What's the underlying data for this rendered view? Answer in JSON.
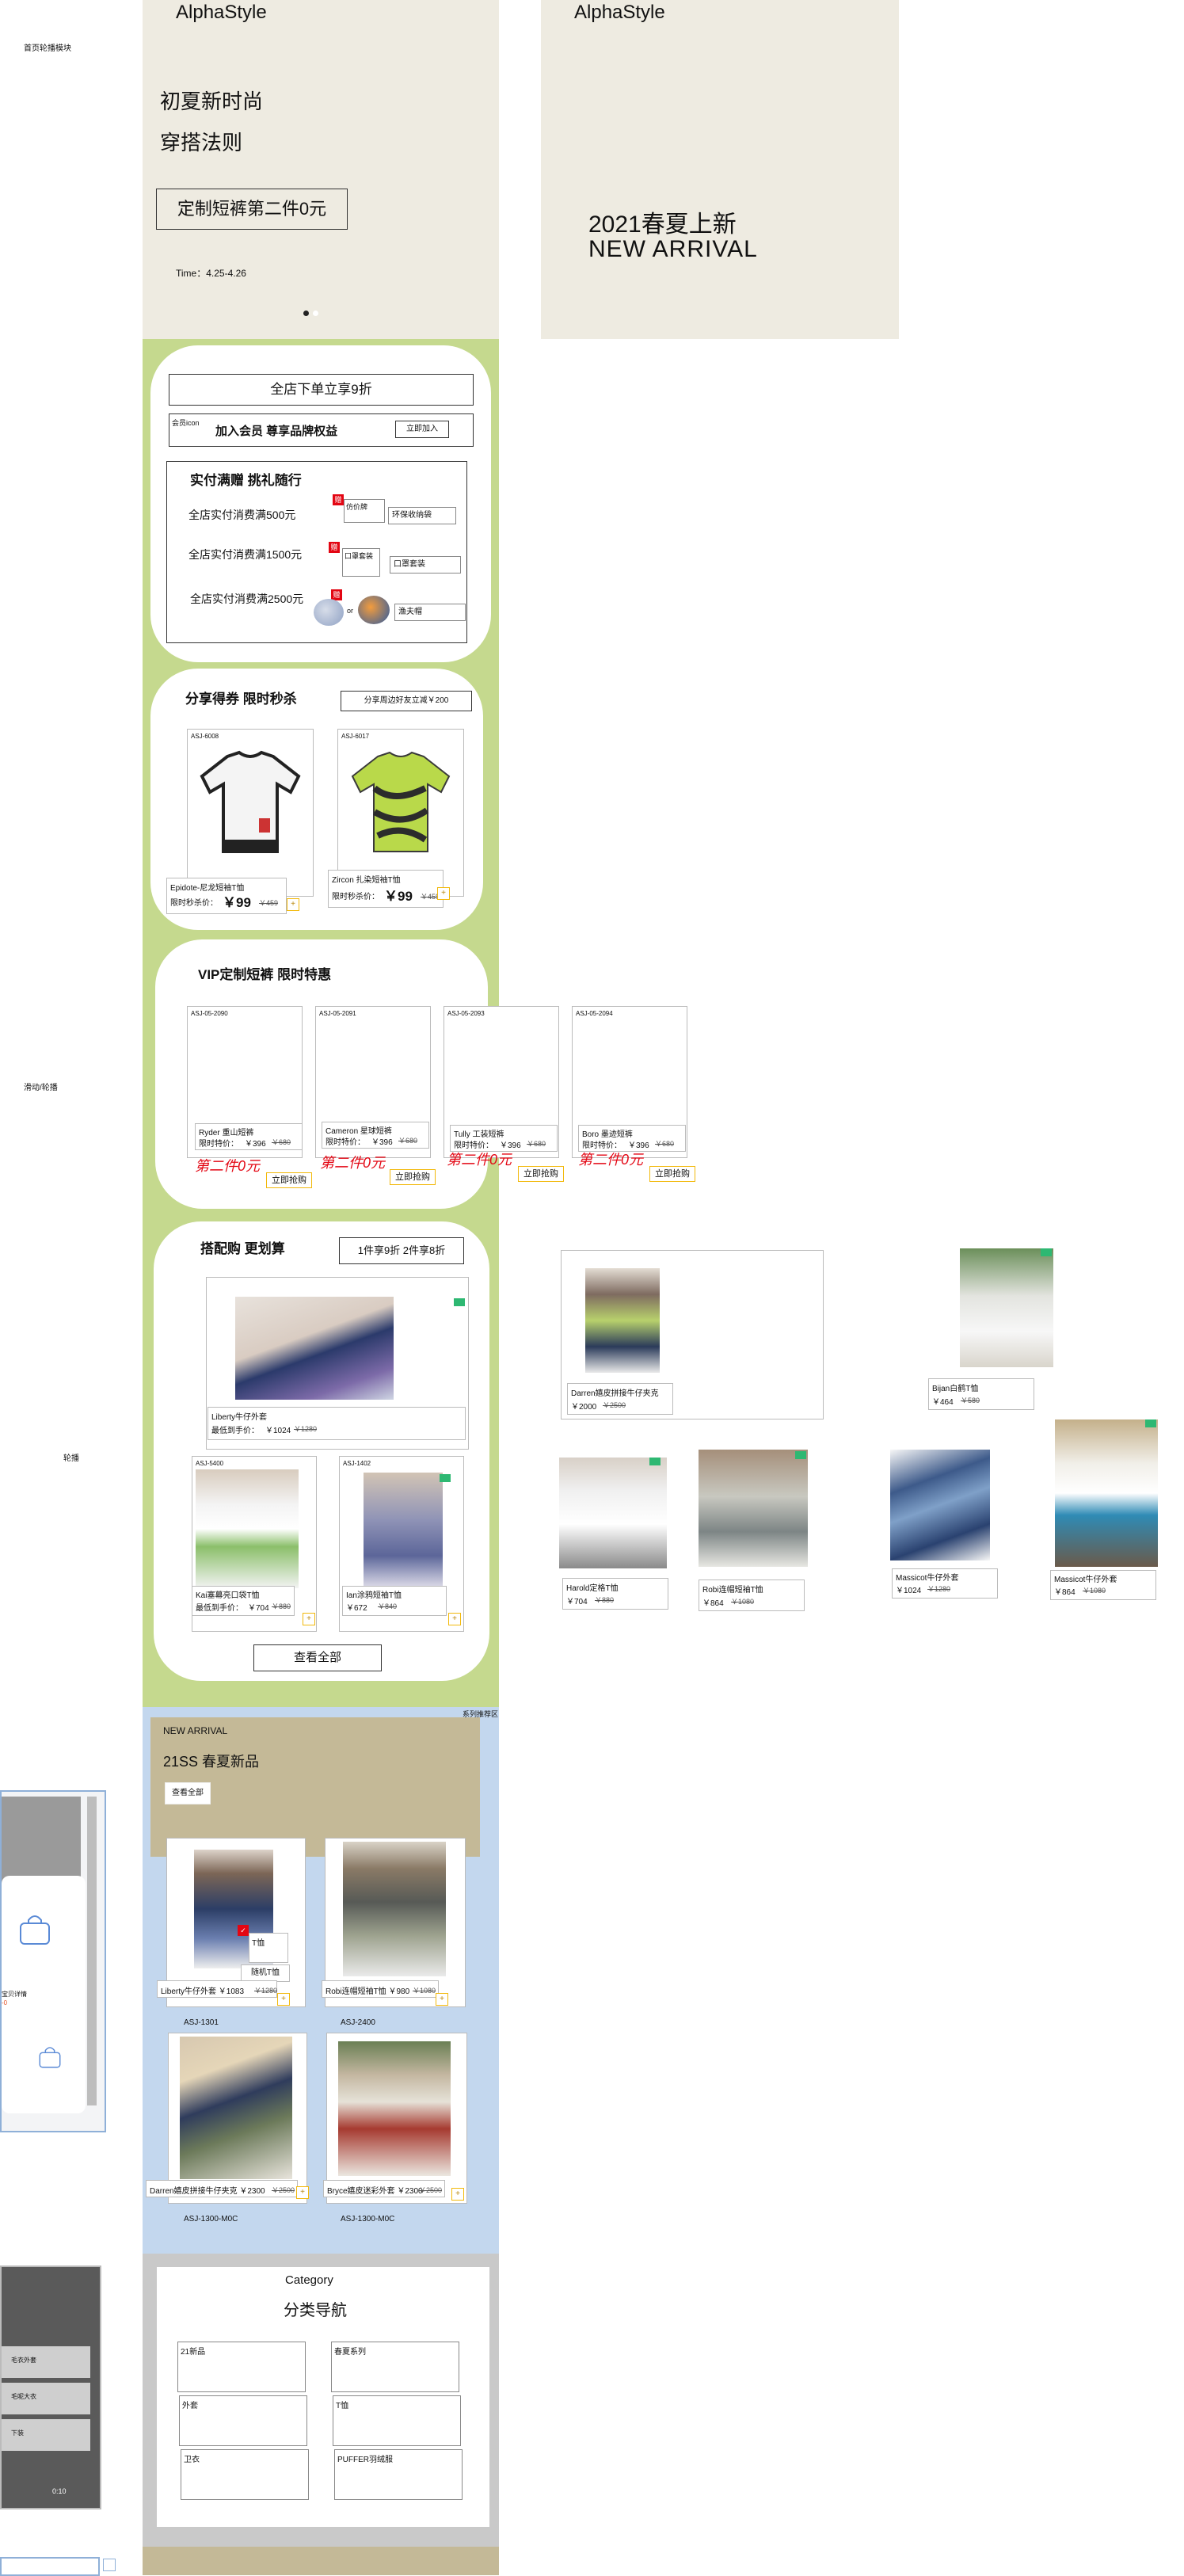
{
  "side_labels": {
    "top": "首页轮播模块",
    "mid": "滑动/轮播",
    "mid2": "轮播",
    "right_tag": "系列推荐区"
  },
  "hero": {
    "brand": "AlphaStyle",
    "line1": "初夏新时尚",
    "line2": "穿搭法则",
    "cta": "定制短裤第二件0元",
    "time": "Time：4.25-4.26"
  },
  "hero2": {
    "brand": "AlphaStyle",
    "line1": "2021春夏上新",
    "line2": "NEW ARRIVAL"
  },
  "promo": {
    "discount_banner": "全店下单立享9折",
    "member_icon": "会员icon",
    "member_text": "加入会员 尊享品牌权益",
    "member_btn": "立即加入",
    "gift_title": "实付满赠 挑礼随行",
    "tiers": [
      {
        "cond": "全店实付消费满500元",
        "gift1": "仿价牌",
        "gift2": "环保收纳袋"
      },
      {
        "cond": "全店实付消费满1500元",
        "gift1": "口罩套装",
        "gift2": "口罩套装"
      },
      {
        "cond": "全店实付消费满2500元",
        "gift1": "or",
        "gift2": "渔夫帽"
      }
    ]
  },
  "flash": {
    "title": "分享得券 限时秒杀",
    "share_btn": "分享周边好友立减￥200",
    "items": [
      {
        "sku": "ASJ-6008",
        "name": "Epidote-尼龙短袖T恤",
        "label": "限时秒杀价：",
        "price": "￥99",
        "old": "￥459"
      },
      {
        "sku": "ASJ-6017",
        "name": "Zircon 扎染短袖T恤",
        "label": "限时秒杀价：",
        "price": "￥99",
        "old": "￥459"
      }
    ]
  },
  "vip": {
    "title": "VIP定制短裤 限时特惠",
    "items": [
      {
        "sku": "ASJ-05-2090",
        "name": "Ryder 重山短裤",
        "label": "限时特价：",
        "price": "￥396",
        "old": "￥680",
        "tag": "第二件0元",
        "btn": "立即抢购"
      },
      {
        "sku": "ASJ-05-2091",
        "name": "Cameron 星球短裤",
        "label": "限时特价：",
        "price": "￥396",
        "old": "￥680",
        "tag": "第二件0元",
        "btn": "立即抢购"
      },
      {
        "sku": "ASJ-05-2093",
        "name": "Tully 工装短裤",
        "label": "限时特价：",
        "price": "￥396",
        "old": "￥680",
        "tag": "第二件0元",
        "btn": "立即抢购"
      },
      {
        "sku": "ASJ-05-2094",
        "name": "Boro 墨迹短裤",
        "label": "限时特价：",
        "price": "￥396",
        "old": "￥680",
        "tag": "第二件0元",
        "btn": "立即抢购"
      }
    ]
  },
  "match": {
    "title": "搭配购 更划算",
    "deal_btn": "1件享9折 2件享8折",
    "main": {
      "name": "Liberty牛仔外套",
      "label": "最低到手价：",
      "price": "￥1024",
      "old": "￥1280"
    },
    "items": [
      {
        "sku": "ASJ-5400",
        "name": "Kai塞幕亮口袋T恤",
        "label": "最低到手价：",
        "price": "￥704",
        "old": "￥880"
      },
      {
        "sku": "ASJ-1402",
        "name": "Ian涂鸦短袖T恤",
        "label": "",
        "price": "￥672",
        "old": "￥840"
      }
    ],
    "view_all": "查看全部"
  },
  "right_products": [
    {
      "name": "Darren嬉皮拼接牛仔夹克",
      "price": "￥2000",
      "old": "￥2500"
    },
    {
      "name": "Bijan白鹤T恤",
      "price": "￥464",
      "old": "￥580"
    },
    {
      "name": "Harold定格T恤",
      "price": "￥704",
      "old": "￥880"
    },
    {
      "name": "Robi连帽短袖T恤",
      "price": "￥864",
      "old": "￥1080"
    },
    {
      "name": "Massicot牛仔外套",
      "price": "￥1024",
      "old": "￥1280"
    },
    {
      "name": "Massicot牛仔外套",
      "price": "￥864",
      "old": "￥1080"
    }
  ],
  "new_arrival": {
    "label": "NEW ARRIVAL",
    "title": "21SS  春夏新品",
    "btn": "查看全部",
    "items": [
      {
        "text": "Liberty牛仔外套 ￥1083",
        "old": "￥1280",
        "sku": "ASJ-1301"
      },
      {
        "text": "Robi连帽短袖T恤 ￥980",
        "old": "￥1080",
        "sku": "ASJ-2400"
      },
      {
        "text": "Darren嬉皮拼接牛仔夹克 ￥2300",
        "old": "￥2500",
        "sku": "ASJ-1300-M0C"
      },
      {
        "text": "Bryce嬉皮迷彩外套 ￥2300",
        "old": "￥2500",
        "sku": "ASJ-1300-M0C"
      }
    ],
    "tooltip": {
      "t1": "T恤",
      "t2": "随机T恤"
    }
  },
  "category": {
    "en": "Category",
    "cn": "分类导航",
    "cells": [
      "21新品",
      "春夏系列",
      "外套",
      "T恤",
      "卫衣",
      "PUFFER羽绒服"
    ]
  },
  "phone_mock": {
    "side_text": "宝贝详情",
    "price_hint": "-0",
    "list": [
      "毛衣外套",
      "毛呢大衣",
      "下装"
    ],
    "time": "0:10"
  },
  "colors": {
    "hero_bg": "#eeebe1",
    "green": "#c5d98e",
    "blue": "#c3d7ee",
    "khaki": "#c4b997",
    "gray": "#c9c9c9",
    "red": "#e30613",
    "yellow": "#f2b90c"
  }
}
